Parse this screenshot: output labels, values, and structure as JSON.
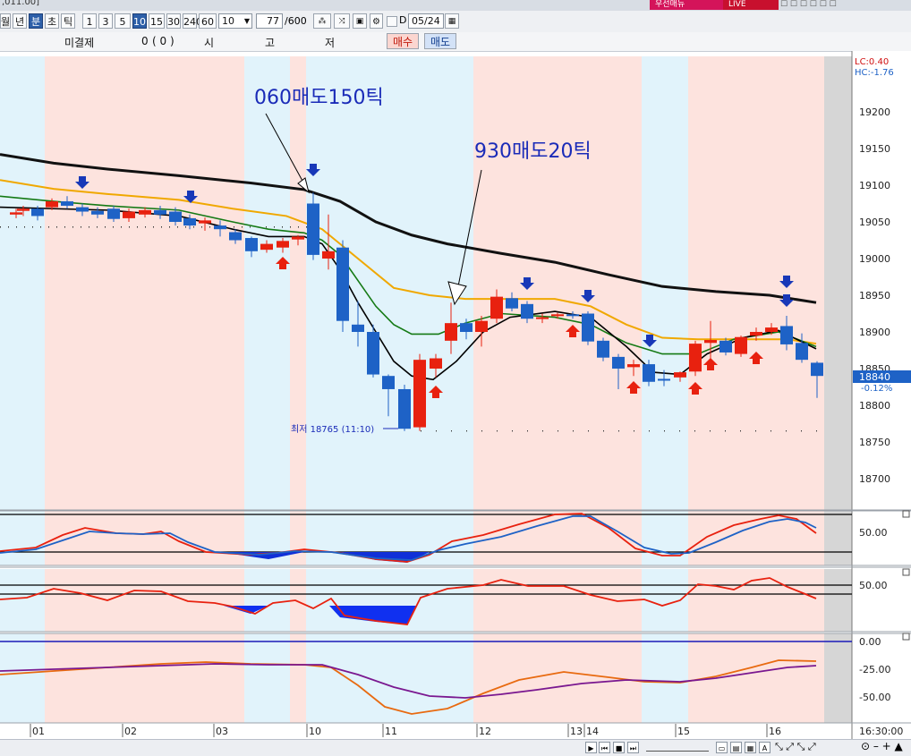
{
  "window": {
    "title_fragment": ",011.00]",
    "badge_red": "우선매뉴",
    "badge_live": "LIVE"
  },
  "toolbar": {
    "period_buttons": [
      "월",
      "년",
      "분",
      "초",
      "틱"
    ],
    "selected_period": "분",
    "minute_buttons": [
      "1",
      "3",
      "5",
      "10",
      "15",
      "30",
      "240",
      "60"
    ],
    "selected_minute": "10",
    "interval_select": "10",
    "count_value": "77",
    "count_total": "/600",
    "date_value": "05/24",
    "icons": [
      "pattern-icon",
      "compare-icon",
      "save-icon",
      "settings-icon",
      "checkbox",
      "calendar-icon"
    ]
  },
  "order_row": {
    "label_unsettled": "미결제",
    "unsettled_value": "0",
    "paren_value": "(      0      )",
    "label_open": "시",
    "label_high": "고",
    "label_low": "저",
    "buy_label": "매수",
    "sell_label": "매도"
  },
  "colors": {
    "up": "#e8210f",
    "down": "#1e62c6",
    "ma_long": "#111111",
    "ma_mid": "#f0a800",
    "ma_short1": "#157a15",
    "ma_short2": "#000000",
    "signal_buy": "#e8210f",
    "signal_sell": "#1838b8",
    "session_pink": "#fde3de",
    "session_blue": "#e1f3fb"
  },
  "chart_data": [
    {
      "type": "candlestick",
      "ylim": [
        18650,
        19250
      ],
      "y_ticks": [
        19200,
        19150,
        19100,
        19050,
        19000,
        18950,
        18900,
        18850,
        18800,
        18750,
        18700
      ],
      "y_tick_labels": [
        "19200",
        "19150",
        "19100",
        "19050",
        "19000",
        "18950",
        "18900",
        "18850",
        "18800",
        "18750",
        "18700"
      ],
      "x_tick_labels": [
        "01",
        "02",
        "03",
        "10",
        "11",
        "12",
        "13",
        "14",
        "15",
        "16"
      ],
      "time_right": "16:30:00",
      "lc_label": "LC:0.40",
      "hc_label": "HC:-1.76",
      "current_price": "18840",
      "current_change": "-0.12%",
      "low_marker": "최저 18765 (11:10)",
      "annotations": [
        "060매도150틱",
        "930매도20틱"
      ],
      "candles": [
        {
          "x": 18,
          "o": 19060,
          "h": 19068,
          "c": 19063,
          "l": 19055
        },
        {
          "x": 26,
          "o": 19065,
          "h": 19072,
          "c": 19068,
          "l": 19058
        },
        {
          "x": 42,
          "o": 19068,
          "h": 19072,
          "c": 19058,
          "l": 19052
        },
        {
          "x": 58,
          "o": 19070,
          "h": 19082,
          "c": 19078,
          "l": 19066
        },
        {
          "x": 75,
          "o": 19078,
          "h": 19085,
          "c": 19072,
          "l": 19068
        },
        {
          "x": 92,
          "o": 19070,
          "h": 19075,
          "c": 19064,
          "l": 19058
        },
        {
          "x": 109,
          "o": 19065,
          "h": 19070,
          "c": 19060,
          "l": 19055
        },
        {
          "x": 127,
          "o": 19068,
          "h": 19072,
          "c": 19054,
          "l": 19050
        },
        {
          "x": 144,
          "o": 19055,
          "h": 19068,
          "c": 19064,
          "l": 19050
        },
        {
          "x": 162,
          "o": 19060,
          "h": 19070,
          "c": 19066,
          "l": 19056
        },
        {
          "x": 179,
          "o": 19066,
          "h": 19072,
          "c": 19060,
          "l": 19054
        },
        {
          "x": 196,
          "o": 19064,
          "h": 19070,
          "c": 19050,
          "l": 19045
        },
        {
          "x": 212,
          "o": 19055,
          "h": 19060,
          "c": 19045,
          "l": 19040
        },
        {
          "x": 229,
          "o": 19048,
          "h": 19056,
          "c": 19052,
          "l": 19038
        },
        {
          "x": 246,
          "o": 19045,
          "h": 19052,
          "c": 19040,
          "l": 19030
        },
        {
          "x": 263,
          "o": 19036,
          "h": 19040,
          "c": 19025,
          "l": 19020
        },
        {
          "x": 281,
          "o": 19028,
          "h": 19030,
          "c": 19010,
          "l": 19002
        },
        {
          "x": 298,
          "o": 19012,
          "h": 19025,
          "c": 19020,
          "l": 19008
        },
        {
          "x": 316,
          "o": 19015,
          "h": 19028,
          "c": 19024,
          "l": 19008
        },
        {
          "x": 333,
          "o": 19026,
          "h": 19032,
          "c": 19030,
          "l": 19018
        },
        {
          "x": 350,
          "o": 19075,
          "h": 19090,
          "c": 19005,
          "l": 18998
        },
        {
          "x": 367,
          "o": 19000,
          "h": 19060,
          "c": 19010,
          "l": 18985
        },
        {
          "x": 383,
          "o": 19015,
          "h": 19025,
          "c": 18915,
          "l": 18900
        },
        {
          "x": 400,
          "o": 18910,
          "h": 18942,
          "c": 18900,
          "l": 18880
        },
        {
          "x": 417,
          "o": 18900,
          "h": 18910,
          "c": 18842,
          "l": 18838
        },
        {
          "x": 434,
          "o": 18840,
          "h": 18842,
          "c": 18822,
          "l": 18785
        },
        {
          "x": 452,
          "o": 18822,
          "h": 18828,
          "c": 18768,
          "l": 18765
        },
        {
          "x": 469,
          "o": 18770,
          "h": 18870,
          "c": 18862,
          "l": 18765
        },
        {
          "x": 487,
          "o": 18850,
          "h": 18870,
          "c": 18864,
          "l": 18838
        },
        {
          "x": 504,
          "o": 18888,
          "h": 18940,
          "c": 18912,
          "l": 18870
        },
        {
          "x": 521,
          "o": 18912,
          "h": 18918,
          "c": 18900,
          "l": 18890
        },
        {
          "x": 538,
          "o": 18900,
          "h": 18922,
          "c": 18915,
          "l": 18880
        },
        {
          "x": 555,
          "o": 18918,
          "h": 18958,
          "c": 18948,
          "l": 18912
        },
        {
          "x": 572,
          "o": 18946,
          "h": 18954,
          "c": 18932,
          "l": 18928
        },
        {
          "x": 589,
          "o": 18938,
          "h": 18942,
          "c": 18918,
          "l": 18912
        },
        {
          "x": 606,
          "o": 18920,
          "h": 18925,
          "c": 18920,
          "l": 18912
        },
        {
          "x": 623,
          "o": 18922,
          "h": 18926,
          "c": 18924,
          "l": 18918
        },
        {
          "x": 640,
          "o": 18924,
          "h": 18928,
          "c": 18922,
          "l": 18918
        },
        {
          "x": 657,
          "o": 18925,
          "h": 18928,
          "c": 18887,
          "l": 18882
        },
        {
          "x": 674,
          "o": 18888,
          "h": 18892,
          "c": 18865,
          "l": 18860
        },
        {
          "x": 691,
          "o": 18866,
          "h": 18870,
          "c": 18850,
          "l": 18822
        },
        {
          "x": 708,
          "o": 18852,
          "h": 18862,
          "c": 18856,
          "l": 18840
        },
        {
          "x": 725,
          "o": 18856,
          "h": 18862,
          "c": 18832,
          "l": 18826
        },
        {
          "x": 742,
          "o": 18836,
          "h": 18848,
          "c": 18834,
          "l": 18826
        },
        {
          "x": 760,
          "o": 18838,
          "h": 18846,
          "c": 18845,
          "l": 18832
        },
        {
          "x": 777,
          "o": 18846,
          "h": 18888,
          "c": 18884,
          "l": 18840
        },
        {
          "x": 794,
          "o": 18885,
          "h": 18915,
          "c": 18889,
          "l": 18858
        },
        {
          "x": 811,
          "o": 18888,
          "h": 18892,
          "c": 18872,
          "l": 18868
        },
        {
          "x": 828,
          "o": 18870,
          "h": 18895,
          "c": 18893,
          "l": 18866
        },
        {
          "x": 845,
          "o": 18895,
          "h": 18906,
          "c": 18900,
          "l": 18888
        },
        {
          "x": 862,
          "o": 18900,
          "h": 18912,
          "c": 18906,
          "l": 18896
        },
        {
          "x": 879,
          "o": 18908,
          "h": 18922,
          "c": 18883,
          "l": 18875
        },
        {
          "x": 896,
          "o": 18885,
          "h": 18898,
          "c": 18862,
          "l": 18858
        },
        {
          "x": 913,
          "o": 18858,
          "h": 18860,
          "c": 18840,
          "l": 18810
        }
      ]
    },
    {
      "type": "line",
      "name": "stochastic",
      "ylim": [
        0,
        100
      ],
      "tick_labels": [
        "50.00"
      ],
      "series": [
        {
          "color": "#e8210f"
        },
        {
          "color": "#1e62c6"
        }
      ]
    },
    {
      "type": "line",
      "name": "rsi",
      "ylim": [
        0,
        100
      ],
      "tick_labels": [
        "50.00"
      ],
      "series": [
        {
          "color": "#e8210f"
        }
      ]
    },
    {
      "type": "line",
      "name": "macd",
      "ylim": [
        -75,
        10
      ],
      "tick_labels": [
        "0.00",
        "-25.00",
        "-50.00"
      ],
      "series": [
        {
          "color": "#e86a10"
        },
        {
          "color": "#7a1890"
        }
      ]
    }
  ]
}
